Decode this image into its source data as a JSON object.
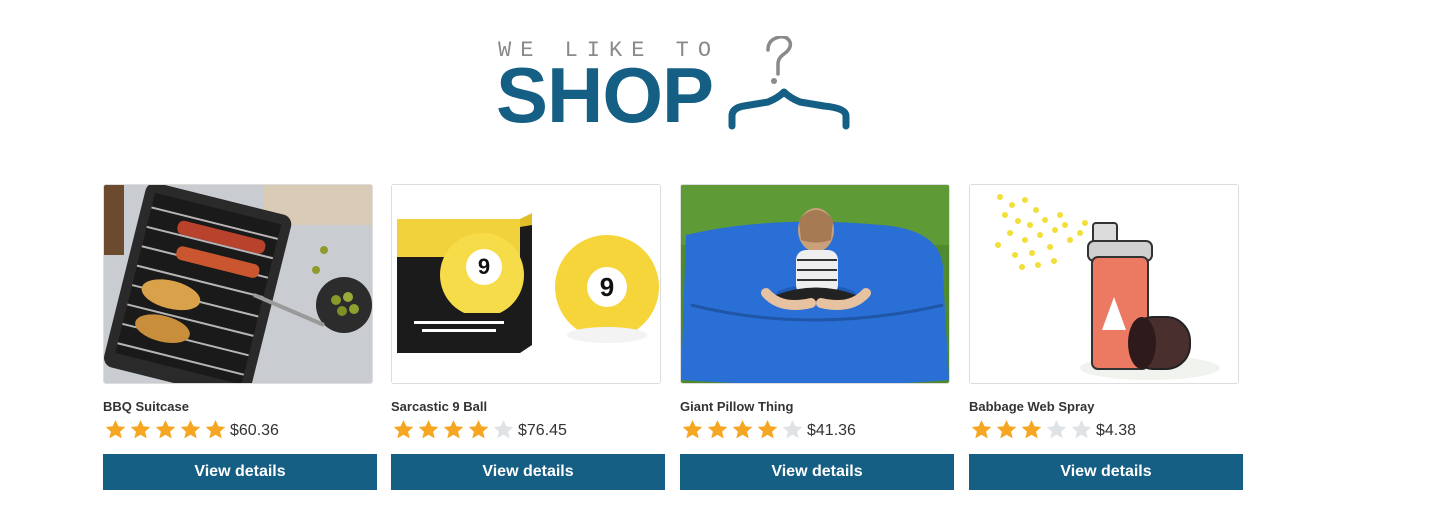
{
  "logo": {
    "tagline": "WE LIKE TO",
    "title": "SHOP",
    "icon": "hanger-icon",
    "color": "#165f84"
  },
  "products": [
    {
      "name": "BBQ Suitcase",
      "price": "$60.36",
      "rating": 5,
      "button": "View details",
      "image": "bbq-grill-image"
    },
    {
      "name": "Sarcastic 9 Ball",
      "price": "$76.45",
      "rating": 4,
      "button": "View details",
      "image": "nine-ball-image"
    },
    {
      "name": "Giant Pillow Thing",
      "price": "$41.36",
      "rating": 4,
      "button": "View details",
      "image": "pillow-image"
    },
    {
      "name": "Babbage Web Spray",
      "price": "$4.38",
      "rating": 3,
      "button": "View details",
      "image": "spray-can-image"
    }
  ],
  "colors": {
    "accent": "#165f84",
    "star_filled": "#f5a623",
    "star_empty": "#e0e3e6"
  }
}
